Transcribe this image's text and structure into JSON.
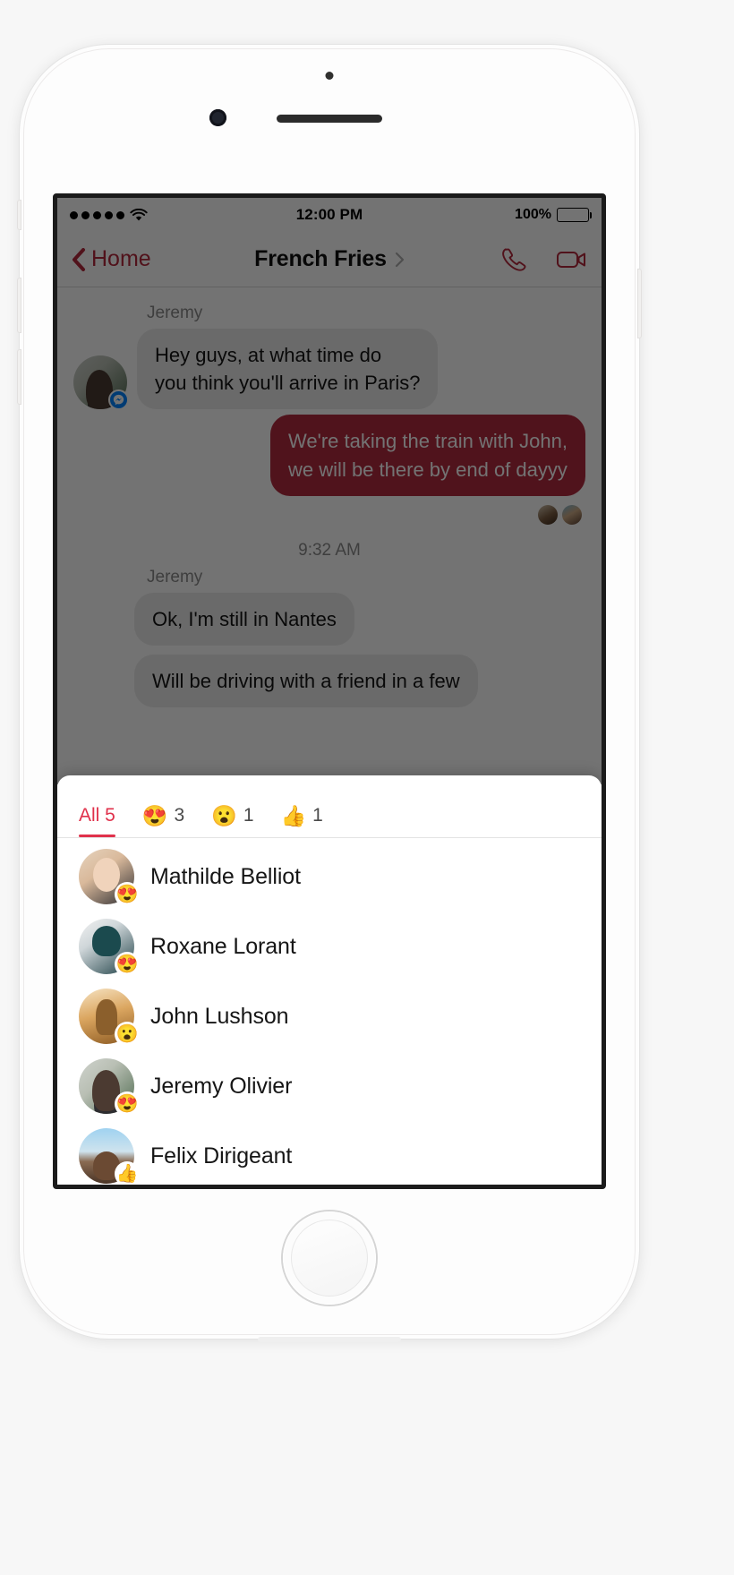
{
  "status_bar": {
    "signal_label": "•••••",
    "wifi_icon": "wifi-icon",
    "time": "12:00 PM",
    "battery_percent": "100%"
  },
  "nav_bar": {
    "back_label": "Home",
    "title": "French Fries",
    "title_chevron": "chevron-right-icon",
    "call_icon": "phone-icon",
    "video_icon": "video-camera-icon",
    "accent_color": "#b4283c"
  },
  "conversation": {
    "messages": [
      {
        "sender": "Jeremy",
        "direction": "in",
        "text": "Hey guys, at what time do\nyou think you'll arrive in Paris?",
        "avatar": "jeremy-avatar",
        "platform_badge": "messenger-icon"
      },
      {
        "sender": "",
        "direction": "out",
        "text": "We're taking the train with John,\nwe will be there by end of dayyy"
      }
    ],
    "read_receipts": [
      "reader-avatar-1",
      "reader-avatar-2"
    ],
    "time_divider": "9:32 AM",
    "messages_after": [
      {
        "sender": "Jeremy",
        "direction": "in",
        "text": "Ok, I'm still in Nantes"
      },
      {
        "sender": "",
        "direction": "in",
        "text": "Will be driving with a friend in a few"
      }
    ]
  },
  "reactions_sheet": {
    "tabs": [
      {
        "label": "All 5",
        "emoji": "",
        "count": "",
        "active": true
      },
      {
        "label": "",
        "emoji": "😍",
        "count": "3",
        "active": false
      },
      {
        "label": "",
        "emoji": "😮",
        "count": "1",
        "active": false
      },
      {
        "label": "",
        "emoji": "👍",
        "count": "1",
        "active": false
      }
    ],
    "people": [
      {
        "name": "Mathilde Belliot",
        "reaction": "😍",
        "avatar": "mathilde-avatar"
      },
      {
        "name": "Roxane Lorant",
        "reaction": "😍",
        "avatar": "roxane-avatar"
      },
      {
        "name": "John Lushson",
        "reaction": "😮",
        "avatar": "john-avatar"
      },
      {
        "name": "Jeremy Olivier",
        "reaction": "😍",
        "avatar": "jeremy-avatar"
      },
      {
        "name": "Felix Dirigeant",
        "reaction": "👍",
        "avatar": "felix-avatar"
      }
    ],
    "active_tab_color": "#e0314b"
  }
}
